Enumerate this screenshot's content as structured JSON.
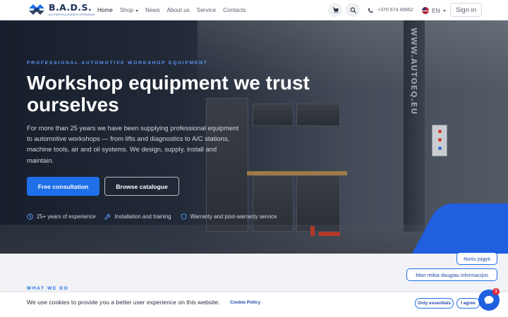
{
  "brand": {
    "name": "B.A.D.S.",
    "tagline": "Autoservisų įrangos sprendimai",
    "accent": "#1f6fe8"
  },
  "nav": {
    "items": [
      {
        "label": "Home",
        "active": true
      },
      {
        "label": "Shop",
        "dropdown": true
      },
      {
        "label": "News"
      },
      {
        "label": "About us"
      },
      {
        "label": "Service"
      },
      {
        "label": "Contacts"
      }
    ],
    "cart_icon": "cart-icon",
    "search_icon": "search-icon",
    "phone": "+370 674 40662",
    "language": "EN",
    "signin": "Sign in"
  },
  "hero": {
    "eyebrow": "PROFESSIONAL AUTOMOTIVE WORKSHOP EQUIPMENT",
    "title": "Workshop equipment we trust ourselves",
    "description": "For more than 25 years we have been supplying professional equipment to automotive workshops — from lifts and diagnostics to A/C stations, machine tools, air and oil systems. We design, supply, install and maintain.",
    "primary_button": "Free consultation",
    "secondary_button": "Browse catalogue",
    "background_sign": "WWW.AUTOEQ.EU",
    "features": [
      {
        "icon": "clock-icon",
        "label": "25+ years of experience"
      },
      {
        "icon": "wrench-icon",
        "label": "Installation and training"
      },
      {
        "icon": "shield-icon",
        "label": "Warranty and post-warranty service"
      }
    ]
  },
  "section": {
    "label": "WHAT WE DO"
  },
  "chat": {
    "quick_replies": [
      "Noriu įsigyti",
      "Man reikia daugiau informacijos"
    ],
    "unread_count": "1"
  },
  "cookie": {
    "text": "We use cookies to provide you a better user experience on this website.",
    "policy_link": "Cookie Policy",
    "essentials_button": "Only essentials",
    "agree_button": "I agree"
  }
}
